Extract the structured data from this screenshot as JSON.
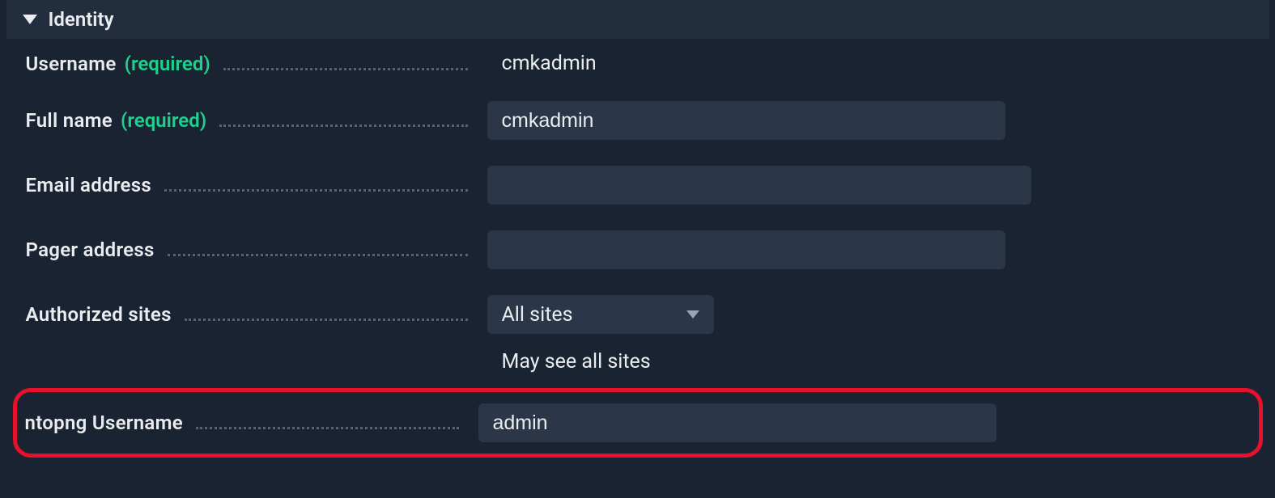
{
  "section": {
    "title": "Identity"
  },
  "fields": {
    "username": {
      "label": "Username",
      "required": "(required)",
      "value": "cmkadmin"
    },
    "fullname": {
      "label": "Full name",
      "required": "(required)",
      "value": "cmkadmin"
    },
    "email": {
      "label": "Email address",
      "value": ""
    },
    "pager": {
      "label": "Pager address",
      "value": ""
    },
    "authsites": {
      "label": "Authorized sites",
      "selected": "All sites",
      "hint": "May see all sites"
    },
    "ntopng": {
      "label": "ntopng Username",
      "value": "admin"
    }
  }
}
